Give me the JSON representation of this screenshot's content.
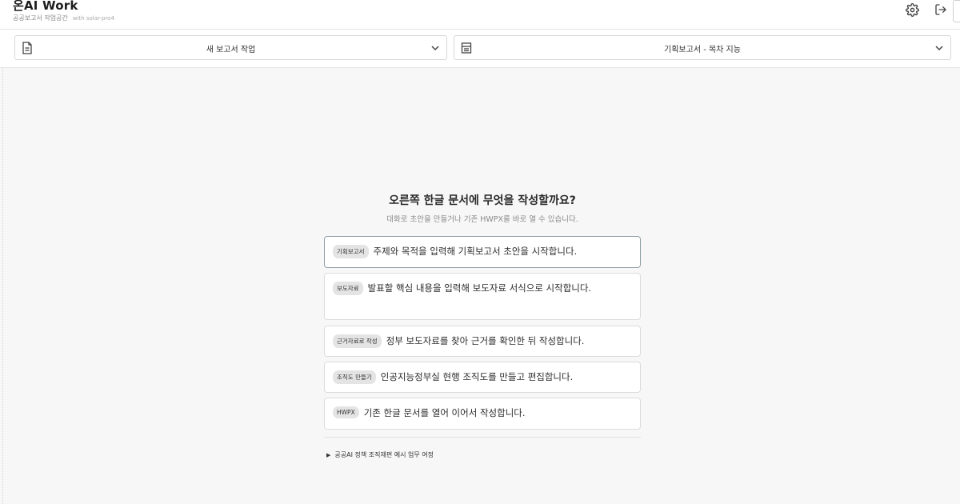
{
  "header": {
    "title": "온AI Work",
    "subtitle": "공공보고서 작업공간",
    "model": "with solar-pro4",
    "settings_icon": "gear-icon",
    "logout_icon": "logout-icon"
  },
  "selectors": {
    "left": {
      "label": "새 보고서 작업",
      "icon": "document-icon"
    },
    "right": {
      "label": "기획보고서 - 목차 지능",
      "icon": "template-icon"
    }
  },
  "main": {
    "heading": "오른쪽 한글 문서에 무엇을 작성할까요?",
    "subheading": "대화로 초안을 만들거나 기존 HWPX를 바로 열 수 있습니다.",
    "cards": [
      {
        "tag": "기획보고서",
        "desc": "주제와 목적을 입력해 기획보고서 초안을 시작합니다."
      },
      {
        "tag": "보도자료",
        "desc": "발표할 핵심 내용을 입력해 보도자료 서식으로 시작합니다."
      },
      {
        "tag": "근거자료로 작성",
        "desc": "정부 보도자료를 찾아 근거를 확인한 뒤 작성합니다."
      },
      {
        "tag": "조직도 만들기",
        "desc": "인공지능정부실 현행 조직도를 만들고 편집합니다."
      },
      {
        "tag": "HWPX",
        "desc": "기존 한글 문서를 열어 이어서 작성합니다."
      }
    ],
    "example_link": "공공AI 정책 조직재편 예시 업무 여정"
  },
  "colors": {
    "accent_border": "#8fa0a8",
    "tag_bg": "#e4e4e4"
  }
}
